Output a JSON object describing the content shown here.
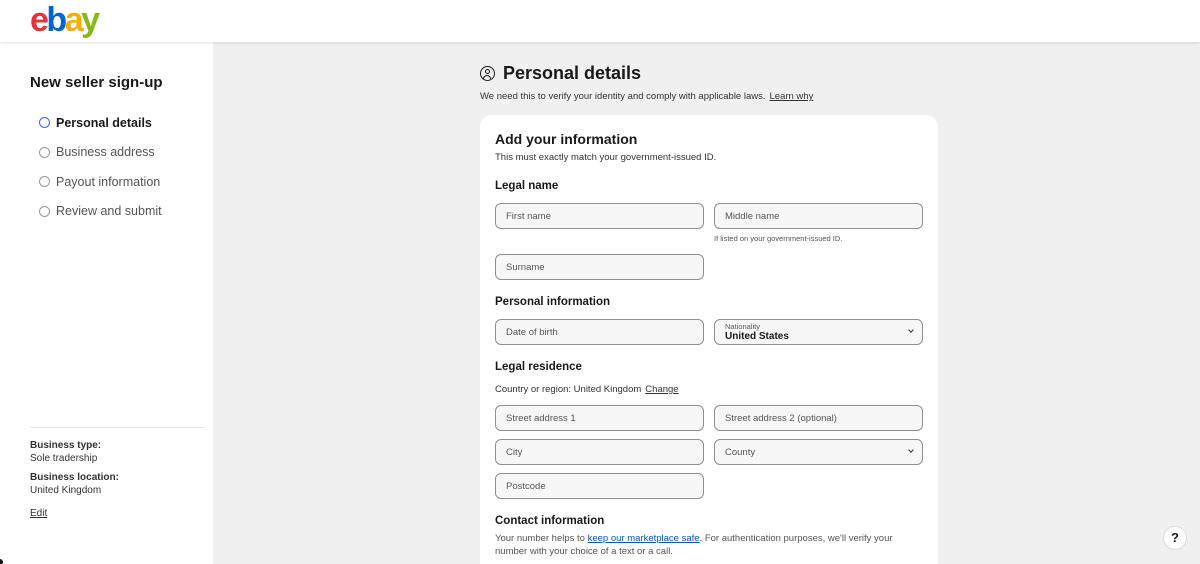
{
  "brand": {
    "logo": [
      "e",
      "b",
      "a",
      "y"
    ]
  },
  "sidebar": {
    "title": "New seller sign-up",
    "steps": [
      {
        "label": "Personal details",
        "active": true
      },
      {
        "label": "Business address",
        "active": false
      },
      {
        "label": "Payout information",
        "active": false
      },
      {
        "label": "Review and submit",
        "active": false
      }
    ],
    "business_type_label": "Business type:",
    "business_type_value": "Sole tradership",
    "business_location_label": "Business location:",
    "business_location_value": "United Kingdom",
    "edit_label": "Edit"
  },
  "header": {
    "title": "Personal details",
    "subtitle": "We need this to verify your identity and comply with applicable laws.",
    "learn_link": "Learn why",
    "icon": "user-circle-icon"
  },
  "card": {
    "title": "Add your information",
    "subtitle": "This must exactly match your government-issued ID.",
    "legal_name": {
      "heading": "Legal name",
      "first_name_placeholder": "First name",
      "middle_name_placeholder": "Middle name",
      "middle_hint": "If listed on your government-issued ID.",
      "surname_placeholder": "Surname"
    },
    "personal_info": {
      "heading": "Personal information",
      "dob_placeholder": "Date of birth",
      "nationality_label": "Nationality",
      "nationality_value": "United States"
    },
    "legal_residence": {
      "heading": "Legal residence",
      "country_text": "Country or region: United Kingdom",
      "change_link": "Change",
      "street1_placeholder": "Street address 1",
      "street2_placeholder": "Street address 2 (optional)",
      "city_placeholder": "City",
      "county_placeholder": "County",
      "postcode_placeholder": "Postcode"
    },
    "contact": {
      "heading": "Contact information",
      "text_before": "Your number helps to ",
      "link": "keep our marketplace safe",
      "text_after": ". For authentication purposes, we'll verify your number with your choice of a text or a call."
    }
  },
  "help_button": "?"
}
